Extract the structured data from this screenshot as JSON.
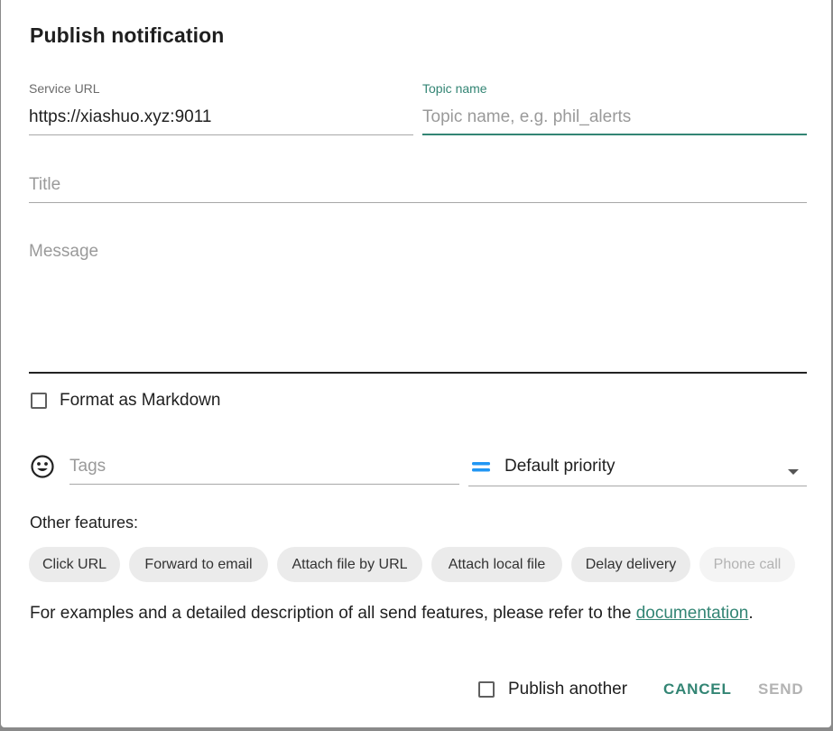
{
  "dialog": {
    "title": "Publish notification"
  },
  "service_url": {
    "label": "Service URL",
    "value": "https://xiashuo.xyz:9011"
  },
  "topic": {
    "label": "Topic name",
    "value": "",
    "placeholder": "Topic name, e.g. phil_alerts"
  },
  "title_field": {
    "value": "",
    "placeholder": "Title"
  },
  "message_field": {
    "value": "",
    "placeholder": "Message"
  },
  "markdown": {
    "label": "Format as Markdown",
    "checked": false
  },
  "tags": {
    "value": "",
    "placeholder": "Tags",
    "icon": "emoji-icon"
  },
  "priority": {
    "value": "Default priority",
    "icon": "priority-default-icon",
    "icon_color": "#2196f3"
  },
  "features": {
    "label": "Other features:",
    "chips": [
      {
        "label": "Click URL",
        "enabled": true
      },
      {
        "label": "Forward to email",
        "enabled": true
      },
      {
        "label": "Attach file by URL",
        "enabled": true
      },
      {
        "label": "Attach local file",
        "enabled": true
      },
      {
        "label": "Delay delivery",
        "enabled": true
      },
      {
        "label": "Phone call",
        "enabled": false
      }
    ]
  },
  "docs": {
    "text": "For examples and a detailed description of all send features, please refer to the",
    "link": "documentation",
    "suffix": "."
  },
  "footer": {
    "publish_another": {
      "label": "Publish another",
      "checked": false
    },
    "cancel": "CANCEL",
    "send": "SEND"
  },
  "colors": {
    "accent": "#338574",
    "disabled": "#b3b3b3"
  }
}
